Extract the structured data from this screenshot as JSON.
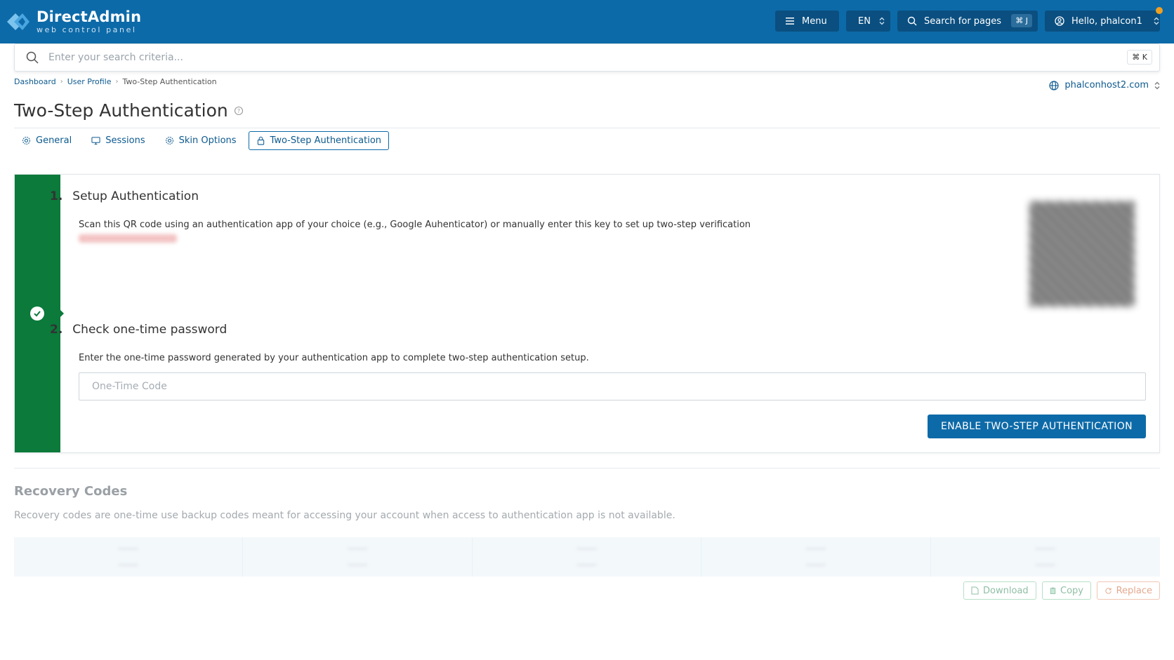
{
  "brand": {
    "title": "DirectAdmin",
    "subtitle": "web control panel"
  },
  "header": {
    "menu_label": "Menu",
    "lang_label": "EN",
    "search_pages_label": "Search for pages",
    "search_pages_shortcut": "⌘ J",
    "user_label": "Hello, phalcon1"
  },
  "search": {
    "placeholder": "Enter your search criteria...",
    "shortcut": "⌘ K"
  },
  "breadcrumb": [
    "Dashboard",
    "User Profile",
    "Two-Step Authentication"
  ],
  "domain_selector": "phalconhost2.com",
  "page_title": "Two-Step Authentication",
  "tabs": [
    {
      "label": "General",
      "icon": "gear-icon"
    },
    {
      "label": "Sessions",
      "icon": "monitor-icon"
    },
    {
      "label": "Skin Options",
      "icon": "gear-icon"
    },
    {
      "label": "Two-Step Authentication",
      "icon": "lock-icon",
      "active": true
    }
  ],
  "setup": {
    "step1_num": "1.",
    "step1_title": "Setup Authentication",
    "step1_desc": "Scan this QR code using an authentication app of your choice (e.g., Google Auhenticator) or manually enter this key to set up two-step verification",
    "step2_num": "2.",
    "step2_title": "Check one-time password",
    "step2_desc": "Enter the one-time password generated by your authentication app to complete two-step authentication setup.",
    "otp_placeholder": "One-Time Code",
    "enable_label": "ENABLE TWO-STEP AUTHENTICATION"
  },
  "recovery": {
    "title": "Recovery Codes",
    "description": "Recovery codes are one-time use backup codes meant for accessing your account when access to authentication app is not available.",
    "download_label": "Download",
    "copy_label": "Copy",
    "replace_label": "Replace"
  },
  "colors": {
    "header_bg": "#0d6aa8",
    "accent": "#0d6aa8",
    "success_stripe": "#0b7a3a",
    "notification": "#f0a020"
  }
}
